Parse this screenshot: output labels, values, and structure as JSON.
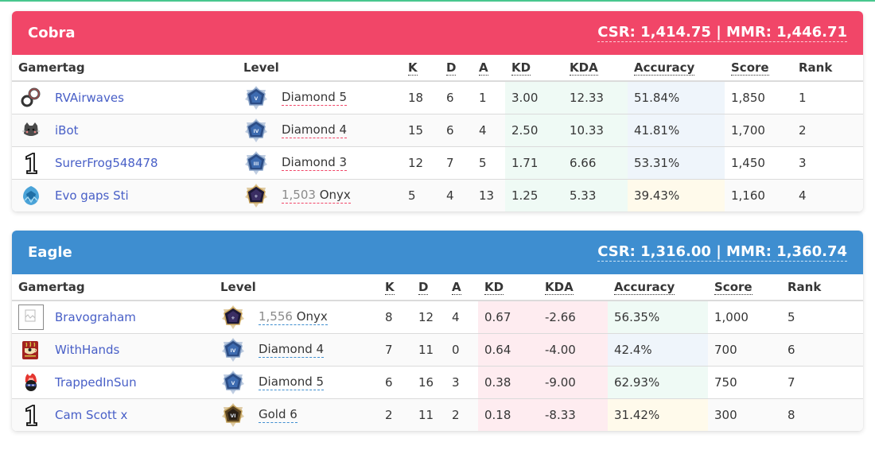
{
  "colors": {
    "top_accent": "#48c78e",
    "cobra": "#f14668",
    "eagle": "#3e8ed0",
    "link": "#485fc7",
    "cell_green": "#effaf5",
    "cell_blue": "#eff5fb",
    "cell_yellow": "#fffaeb",
    "cell_red": "#feecf0"
  },
  "columns": {
    "gamertag": "Gamertag",
    "level": "Level",
    "k": "K",
    "d": "D",
    "a": "A",
    "kd": "KD",
    "kda": "KDA",
    "accuracy": "Accuracy",
    "score": "Score",
    "rank": "Rank"
  },
  "teams": [
    {
      "name": "Cobra",
      "rating": "CSR: 1,414.75 | MMR: 1,446.71",
      "players": [
        {
          "gamertag": "RVAirwaves",
          "avatar": "infinity-knot-icon",
          "rank_icon": "diamond-5-icon",
          "level_csr": "",
          "level": "Diamond 5",
          "k": "18",
          "d": "6",
          "a": "1",
          "kd": "3.00",
          "kda": "12.33",
          "accuracy": "51.84%",
          "score": "1,850",
          "rank": "1",
          "kd_tone": "green",
          "kda_tone": "green",
          "acc_tone": "blue"
        },
        {
          "gamertag": "iBot",
          "avatar": "cat-icon",
          "rank_icon": "diamond-4-icon",
          "level_csr": "",
          "level": "Diamond 4",
          "k": "15",
          "d": "6",
          "a": "4",
          "kd": "2.50",
          "kda": "10.33",
          "accuracy": "41.81%",
          "score": "1,700",
          "rank": "2",
          "kd_tone": "green",
          "kda_tone": "green",
          "acc_tone": "blue"
        },
        {
          "gamertag": "SurerFrog548478",
          "avatar": "number-one-icon",
          "rank_icon": "diamond-3-icon",
          "level_csr": "",
          "level": "Diamond 3",
          "k": "12",
          "d": "7",
          "a": "5",
          "kd": "1.71",
          "kda": "6.66",
          "accuracy": "53.31%",
          "score": "1,450",
          "rank": "3",
          "kd_tone": "green",
          "kda_tone": "green",
          "acc_tone": "blue"
        },
        {
          "gamertag": "Evo gaps Sti",
          "avatar": "blue-spartan-icon",
          "rank_icon": "onyx-icon",
          "level_csr": "1,503",
          "level": "Onyx",
          "k": "5",
          "d": "4",
          "a": "13",
          "kd": "1.25",
          "kda": "5.33",
          "accuracy": "39.43%",
          "score": "1,160",
          "rank": "4",
          "kd_tone": "green",
          "kda_tone": "green",
          "acc_tone": "yellow"
        }
      ]
    },
    {
      "name": "Eagle",
      "rating": "CSR: 1,316.00 | MMR: 1,360.74",
      "players": [
        {
          "gamertag": "Bravograham",
          "avatar": "broken-image-icon",
          "rank_icon": "onyx-icon",
          "level_csr": "1,556",
          "level": "Onyx",
          "k": "8",
          "d": "12",
          "a": "4",
          "kd": "0.67",
          "kda": "-2.66",
          "accuracy": "56.35%",
          "score": "1,000",
          "rank": "5",
          "kd_tone": "red",
          "kda_tone": "red",
          "acc_tone": "green"
        },
        {
          "gamertag": "WithHands",
          "avatar": "coffee-cup-icon",
          "rank_icon": "diamond-4-icon",
          "level_csr": "",
          "level": "Diamond 4",
          "k": "7",
          "d": "11",
          "a": "0",
          "kd": "0.64",
          "kda": "-4.00",
          "accuracy": "42.4%",
          "score": "700",
          "rank": "6",
          "kd_tone": "red",
          "kda_tone": "red",
          "acc_tone": "blue"
        },
        {
          "gamertag": "TrappedInSun",
          "avatar": "flaming-ninja-icon",
          "rank_icon": "diamond-5-icon",
          "level_csr": "",
          "level": "Diamond 5",
          "k": "6",
          "d": "16",
          "a": "3",
          "kd": "0.38",
          "kda": "-9.00",
          "accuracy": "62.93%",
          "score": "750",
          "rank": "7",
          "kd_tone": "red",
          "kda_tone": "red",
          "acc_tone": "green"
        },
        {
          "gamertag": "Cam Scott x",
          "avatar": "number-one-icon",
          "rank_icon": "gold-6-icon",
          "level_csr": "",
          "level": "Gold 6",
          "k": "2",
          "d": "11",
          "a": "2",
          "kd": "0.18",
          "kda": "-8.33",
          "accuracy": "31.42%",
          "score": "300",
          "rank": "8",
          "kd_tone": "red",
          "kda_tone": "red",
          "acc_tone": "yellow"
        }
      ]
    }
  ]
}
